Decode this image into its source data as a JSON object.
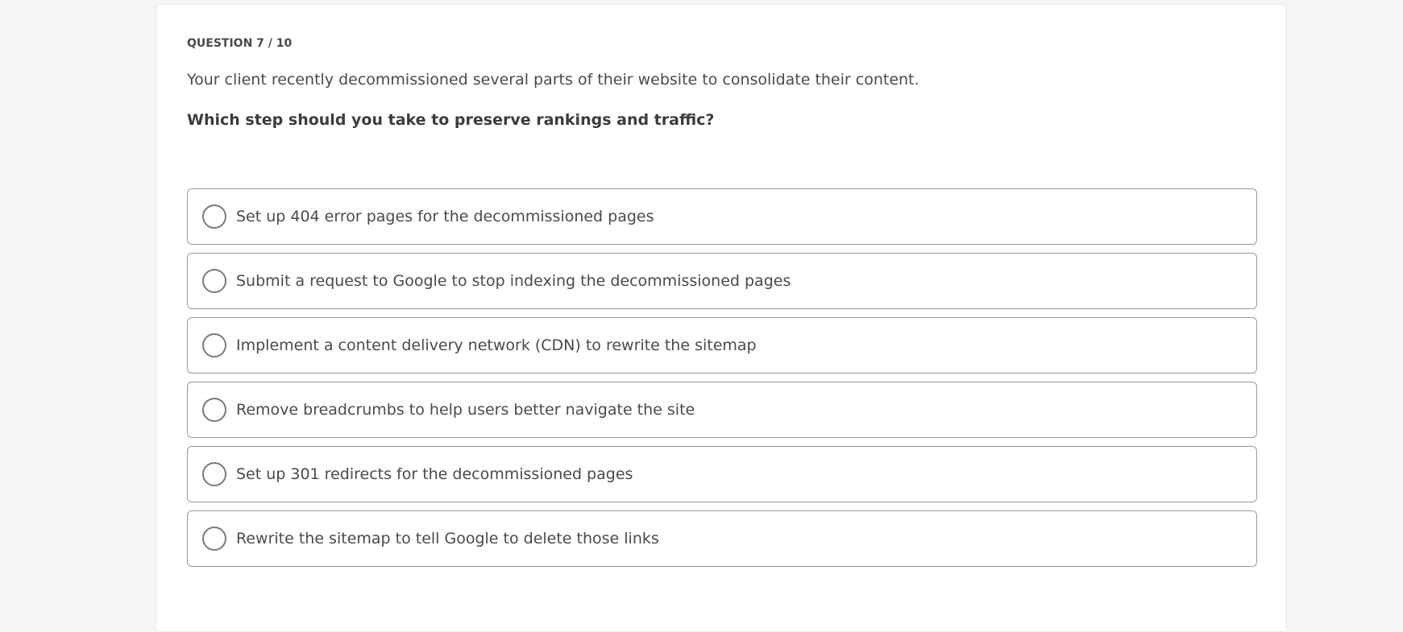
{
  "quiz": {
    "counter": "QUESTION 7 / 10",
    "prompt": "Your client recently decommissioned several parts of their website to consolidate their content.",
    "question": "Which step should you take to preserve rankings and traffic?",
    "options": [
      {
        "label": "Set up 404 error pages for the decommissioned pages",
        "selected": false
      },
      {
        "label": "Submit a request to Google to stop indexing the decommissioned pages",
        "selected": false
      },
      {
        "label": "Implement a content delivery network (CDN) to rewrite the sitemap",
        "selected": false
      },
      {
        "label": "Remove breadcrumbs to help users better navigate the site",
        "selected": false
      },
      {
        "label": "Set up 301 redirects for the decommissioned pages",
        "selected": false
      },
      {
        "label": "Rewrite the sitemap to tell Google to delete those links",
        "selected": false
      }
    ]
  },
  "colors": {
    "page_background": "#f5f5f5",
    "card_background": "#ffffff",
    "text": "#4a4a4a",
    "option_border": "#9a9a9a",
    "radio_border": "#7a7a7a"
  },
  "icons": {
    "radio": "radio-unchecked-icon"
  }
}
